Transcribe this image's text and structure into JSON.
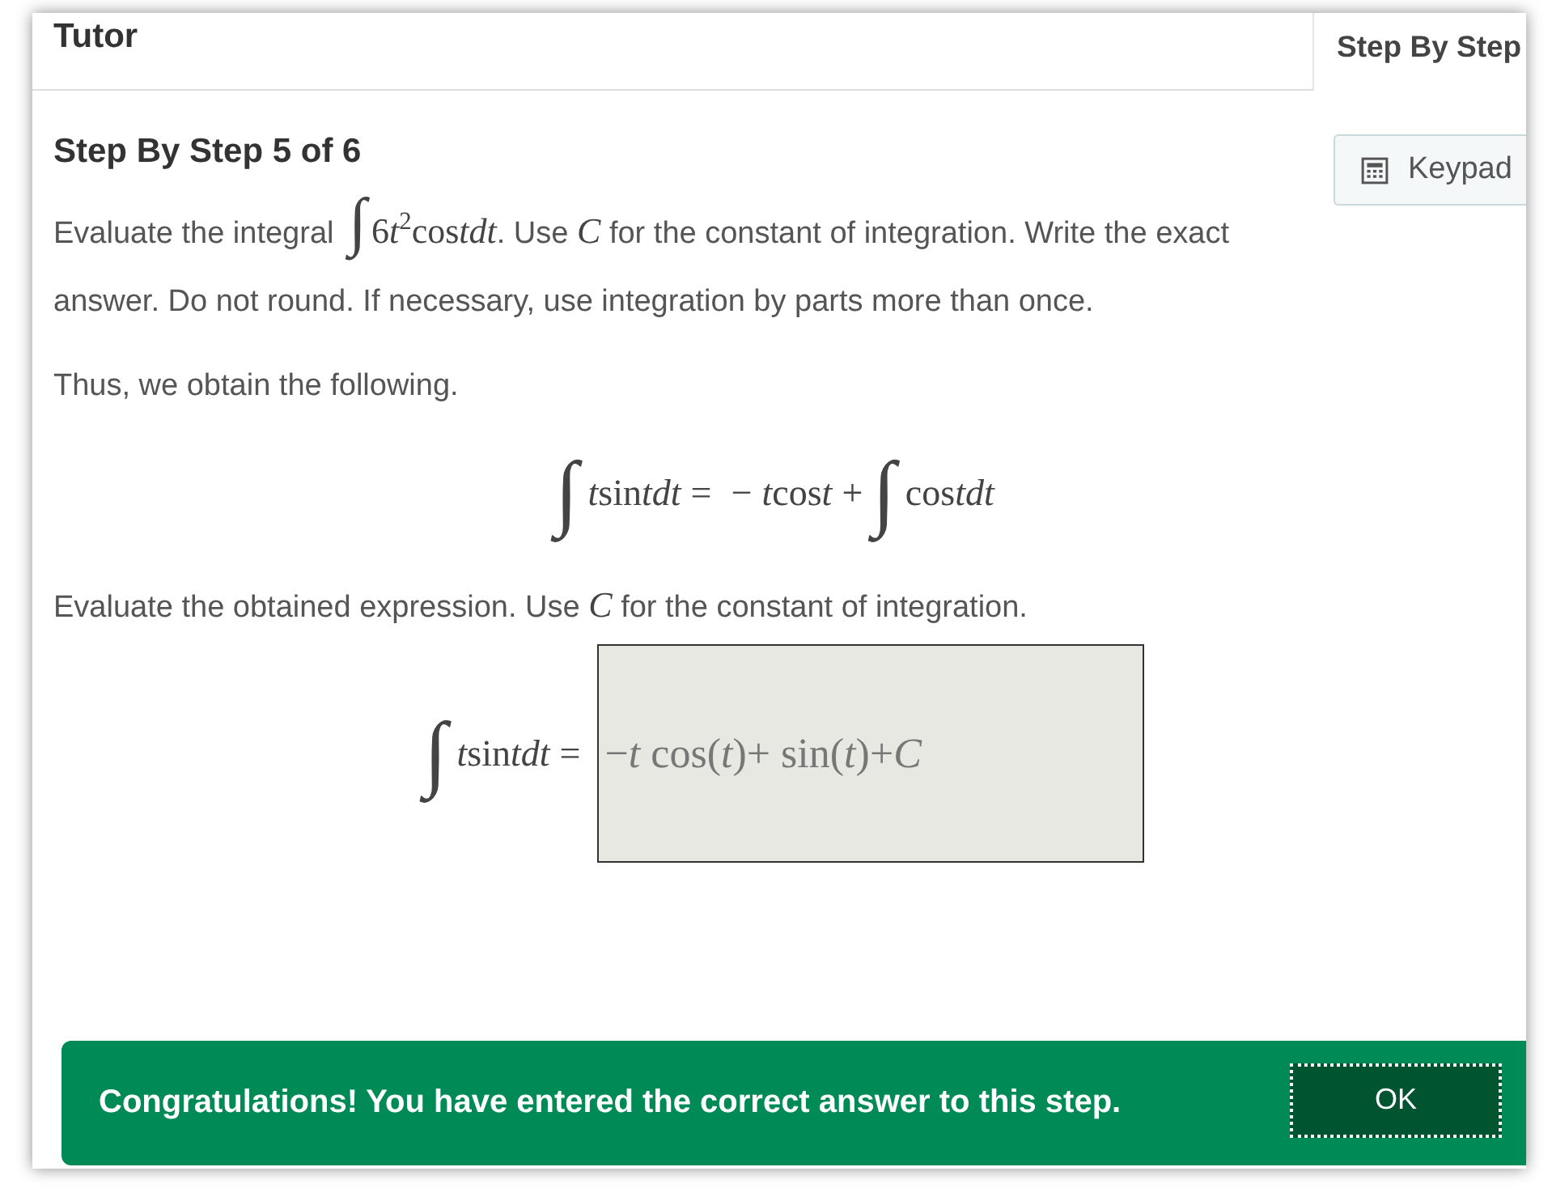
{
  "header": {
    "title": "Tutor"
  },
  "side_tabs": [
    {
      "label": "Step By Step",
      "selected": true
    }
  ],
  "keypad_button": {
    "label": "Keypad"
  },
  "step": {
    "title": "Step By Step 5 of 6",
    "question": [
      {
        "kind": "text",
        "text": "Evaluate the integral "
      },
      {
        "kind": "integral",
        "text": "∫"
      },
      {
        "kind": "math",
        "tokens": [
          {
            "kind": "upright",
            "text": "6"
          },
          {
            "kind": "variable",
            "text": "t"
          },
          {
            "kind": "exponent",
            "text": "2"
          },
          {
            "kind": "upright",
            "text": "cos"
          },
          {
            "kind": "variable",
            "text": "tdt"
          }
        ]
      },
      {
        "kind": "text",
        "text": ". Use "
      },
      {
        "kind": "math",
        "tokens": [
          {
            "kind": "variable",
            "text": "C"
          }
        ]
      },
      {
        "kind": "text",
        "text": " for the constant of integration. Write the exact answer. Do not round. If necessary, use integration by parts more than once."
      }
    ],
    "intro": "Thus, we obtain the following.",
    "equation": [
      {
        "kind": "integral",
        "text": "∫"
      },
      {
        "kind": "math",
        "tokens": [
          {
            "kind": "variable",
            "text": "t"
          },
          {
            "kind": "upright",
            "text": "sin"
          },
          {
            "kind": "variable",
            "text": "tdt"
          },
          {
            "kind": "operator",
            "text": "="
          },
          {
            "kind": "operator",
            "text": "−"
          },
          {
            "kind": "variable",
            "text": "t"
          },
          {
            "kind": "upright",
            "text": "cos"
          },
          {
            "kind": "variable",
            "text": "t"
          },
          {
            "kind": "operator",
            "text": "+"
          }
        ]
      },
      {
        "kind": "integral",
        "text": "∫"
      },
      {
        "kind": "math",
        "tokens": [
          {
            "kind": "upright",
            "text": "cos"
          },
          {
            "kind": "variable",
            "text": "tdt"
          }
        ]
      }
    ],
    "instruction": [
      {
        "kind": "text",
        "text": "Evaluate the obtained expression. Use "
      },
      {
        "kind": "math",
        "tokens": [
          {
            "kind": "variable",
            "text": "C"
          }
        ]
      },
      {
        "kind": "text",
        "text": " for the constant of integration."
      }
    ],
    "answer": {
      "lhs": [
        {
          "kind": "integral",
          "text": "∫"
        },
        {
          "kind": "math",
          "tokens": [
            {
              "kind": "variable",
              "text": "t"
            },
            {
              "kind": "upright",
              "text": "sin"
            },
            {
              "kind": "variable",
              "text": "tdt"
            },
            {
              "kind": "operator",
              "text": "="
            }
          ]
        }
      ],
      "value": "−*t* cos(*t*)+ sin(*t*)+*C*"
    }
  },
  "toast": {
    "message": "Congratulations! You have entered the correct answer to this step.",
    "button": "OK"
  }
}
